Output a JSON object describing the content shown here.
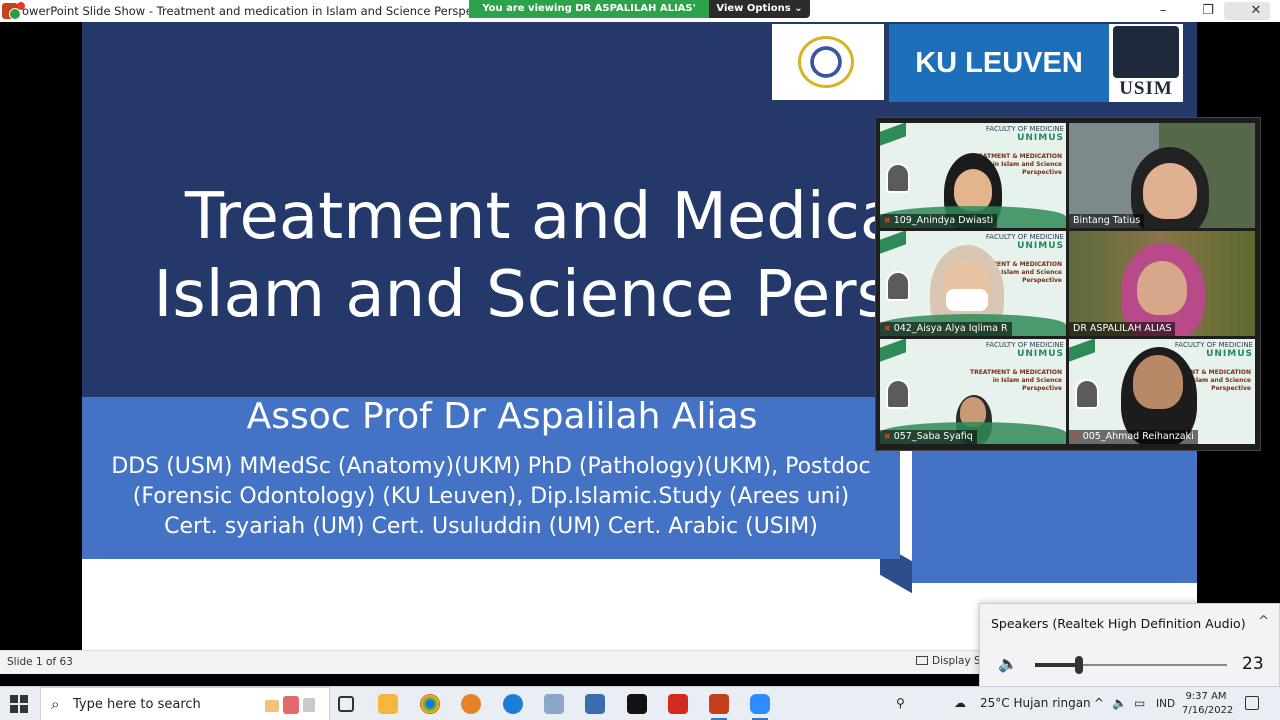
{
  "window": {
    "title": "owerPoint Slide Show  -  Treatment and medication in Islam and Science Perspective",
    "minimize": "–",
    "maximize": "❐",
    "close": "✕"
  },
  "zoom": {
    "share_banner": "You are viewing DR ASPALILAH ALIAS' screen",
    "view_options": "View Options ⌄"
  },
  "slide": {
    "title_line1": "Treatment and Medica",
    "title_line2": "Islam and Science Persp",
    "author": "Assoc Prof Dr Aspalilah Alias",
    "credentials": [
      "DDS (USM) MMedSc (Anatomy)(UKM) PhD (Pathology)(UKM), Postdoc",
      "(Forensic Odontology) (KU Leuven),  Dip.Islamic.Study (Arees uni)",
      "Cert. syariah (UM) Cert. Usuluddin (UM) Cert. Arabic (USIM)"
    ],
    "logos": {
      "ku_leuven": "KU LEUVEN",
      "usim": "USIM"
    }
  },
  "gallery": {
    "participants": [
      {
        "name": "109_Anindya Dwiasti",
        "muted": true
      },
      {
        "name": "Bintang Tatius",
        "muted": false
      },
      {
        "name": "042_Aisya Alya Iqlima R",
        "muted": true
      },
      {
        "name": "DR ASPALILAH ALIAS",
        "muted": false,
        "active": true
      },
      {
        "name": "057_Saba Syafiq",
        "muted": true
      },
      {
        "name": "005_Ahmad Reihanzaki",
        "muted": true
      }
    ],
    "tile_header": {
      "faculty": "FACULTY OF MEDICINE",
      "uni": "UNIMUS",
      "topic_line1": "TREATMENT & MEDICATION",
      "topic_line2": "in Islam and Science",
      "topic_line3": "Perspective"
    }
  },
  "statusbar": {
    "slide_counter": "Slide 1 of 63",
    "display_settings": "Display Se"
  },
  "volume": {
    "device": "Speakers (Realtek High Definition Audio)",
    "level": 23
  },
  "taskbar": {
    "search_placeholder": "Type here to search",
    "weather": "25°C  Hujan ringan",
    "lang": "IND",
    "time": "9:37 AM",
    "date": "7/16/2022"
  },
  "icons": {
    "colors": [
      "#f5b73d",
      "#2a8d2e",
      "#e5832a",
      "#1a7ed8",
      "#3b6cb0",
      "#111",
      "#d42a22",
      "#c43e1c",
      "#2d8cff"
    ]
  }
}
